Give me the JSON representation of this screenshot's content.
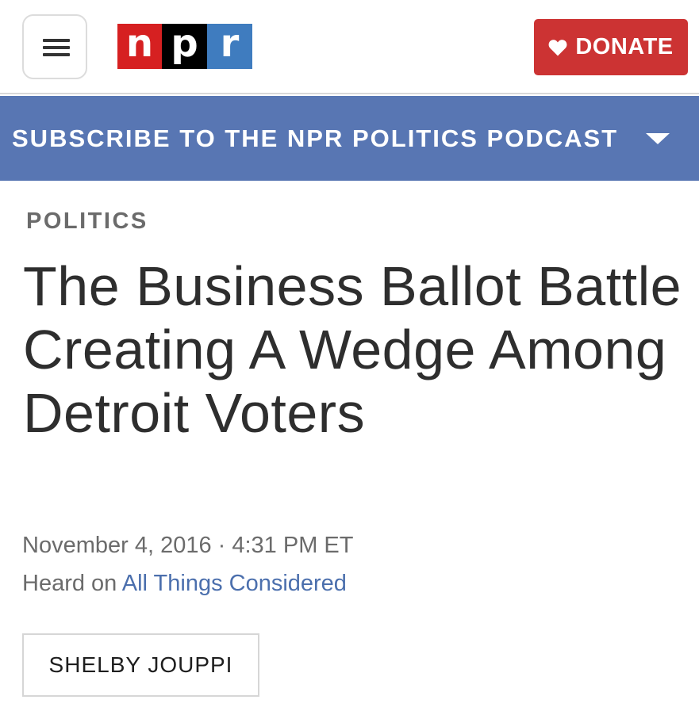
{
  "header": {
    "menu_icon": "hamburger-menu-icon",
    "logo": {
      "letters": [
        "n",
        "p",
        "r"
      ],
      "colors": [
        "#d62021",
        "#000000",
        "#3f7cbf"
      ]
    },
    "donate": {
      "label": "DONATE",
      "icon": "heart-icon",
      "color": "#cc3333"
    }
  },
  "subscribe_bar": {
    "label": "SUBSCRIBE TO THE NPR POLITICS PODCAST",
    "icon": "chevron-down-icon",
    "color": "#5876b3"
  },
  "article": {
    "section": "POLITICS",
    "headline": "The Business Ballot Battle Creating A Wedge Among Detroit Voters",
    "date": "November 4, 2016 · 4:31 PM ET",
    "heard_on_prefix": "Heard on ",
    "heard_on_show": "All Things Considered",
    "byline": "SHELBY JOUPPI"
  }
}
